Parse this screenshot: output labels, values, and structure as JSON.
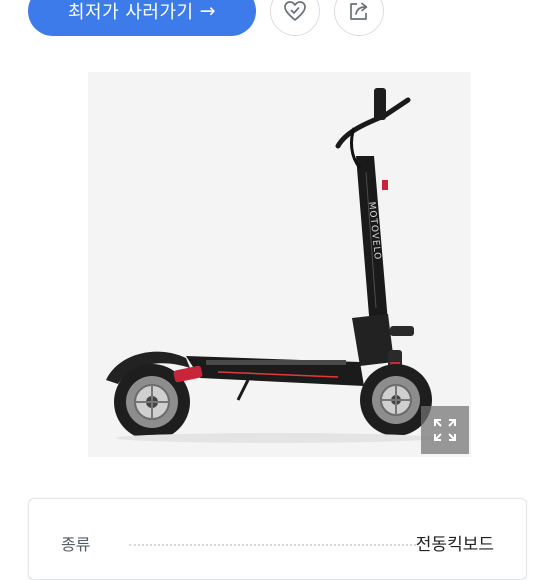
{
  "actions": {
    "buy_label": "최저가 사러가기",
    "buy_arrow": "→"
  },
  "product": {
    "brand_text": "MOTOVELO"
  },
  "specs": [
    {
      "label": "종류",
      "value": "전동킥보드"
    }
  ],
  "colors": {
    "accent": "#3d7bea",
    "image_bg": "#f4f4f4",
    "overlay": "#737373"
  },
  "icons": {
    "like": "heart-check-icon",
    "share": "share-icon",
    "expand": "expand-icon"
  }
}
